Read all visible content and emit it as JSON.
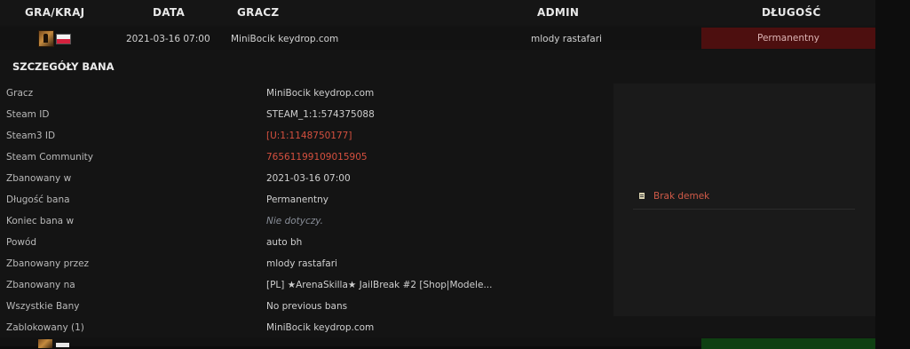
{
  "header": {
    "col_country": "GRA/KRAJ",
    "col_date": "DATA",
    "col_player": "GRACZ",
    "col_admin": "ADMIN",
    "col_length": "DŁUGOŚĆ"
  },
  "ban": {
    "game_icon": "csgo-icon",
    "country_flag": "flag-pl-icon",
    "date": "2021-03-16 07:00",
    "player": "MiniBocik keydrop.com",
    "admin": "mlody rastafari",
    "length": "Permanentny",
    "length_color": "#4d0f0f"
  },
  "details": {
    "title": "SZCZEGÓŁY BANA",
    "rows": [
      {
        "label": "Gracz",
        "value": "MiniBocik keydrop.com"
      },
      {
        "label": "Steam ID",
        "value": "STEAM_1:1:574375088"
      },
      {
        "label": "Steam3 ID",
        "value": "[U:1:1148750177]"
      },
      {
        "label": "Steam Community",
        "value": "76561199109015905"
      },
      {
        "label": "Zbanowany w",
        "value": "2021-03-16 07:00"
      },
      {
        "label": "Długość bana",
        "value": "Permanentny"
      },
      {
        "label": "Koniec bana w",
        "value": "Nie dotyczy."
      },
      {
        "label": "Powód",
        "value": "auto bh"
      },
      {
        "label": "Zbanowany przez",
        "value": "mlody rastafari"
      },
      {
        "label": "Zbanowany na",
        "value": "[PL] ★ArenaSkilla★ JailBreak #2 [Shop|Modele..."
      },
      {
        "label": "Wszystkie Bany",
        "value": "No previous bans"
      },
      {
        "label": "Zablokowany (1)",
        "value": "MiniBocik keydrop.com"
      }
    ]
  },
  "demo": {
    "icon": "demo-file-icon",
    "text": "Brak demek"
  },
  "colors": {
    "link_red": "#d5503f",
    "permanent_bg": "#4d0f0f",
    "next_length_bg": "#0f4012"
  }
}
